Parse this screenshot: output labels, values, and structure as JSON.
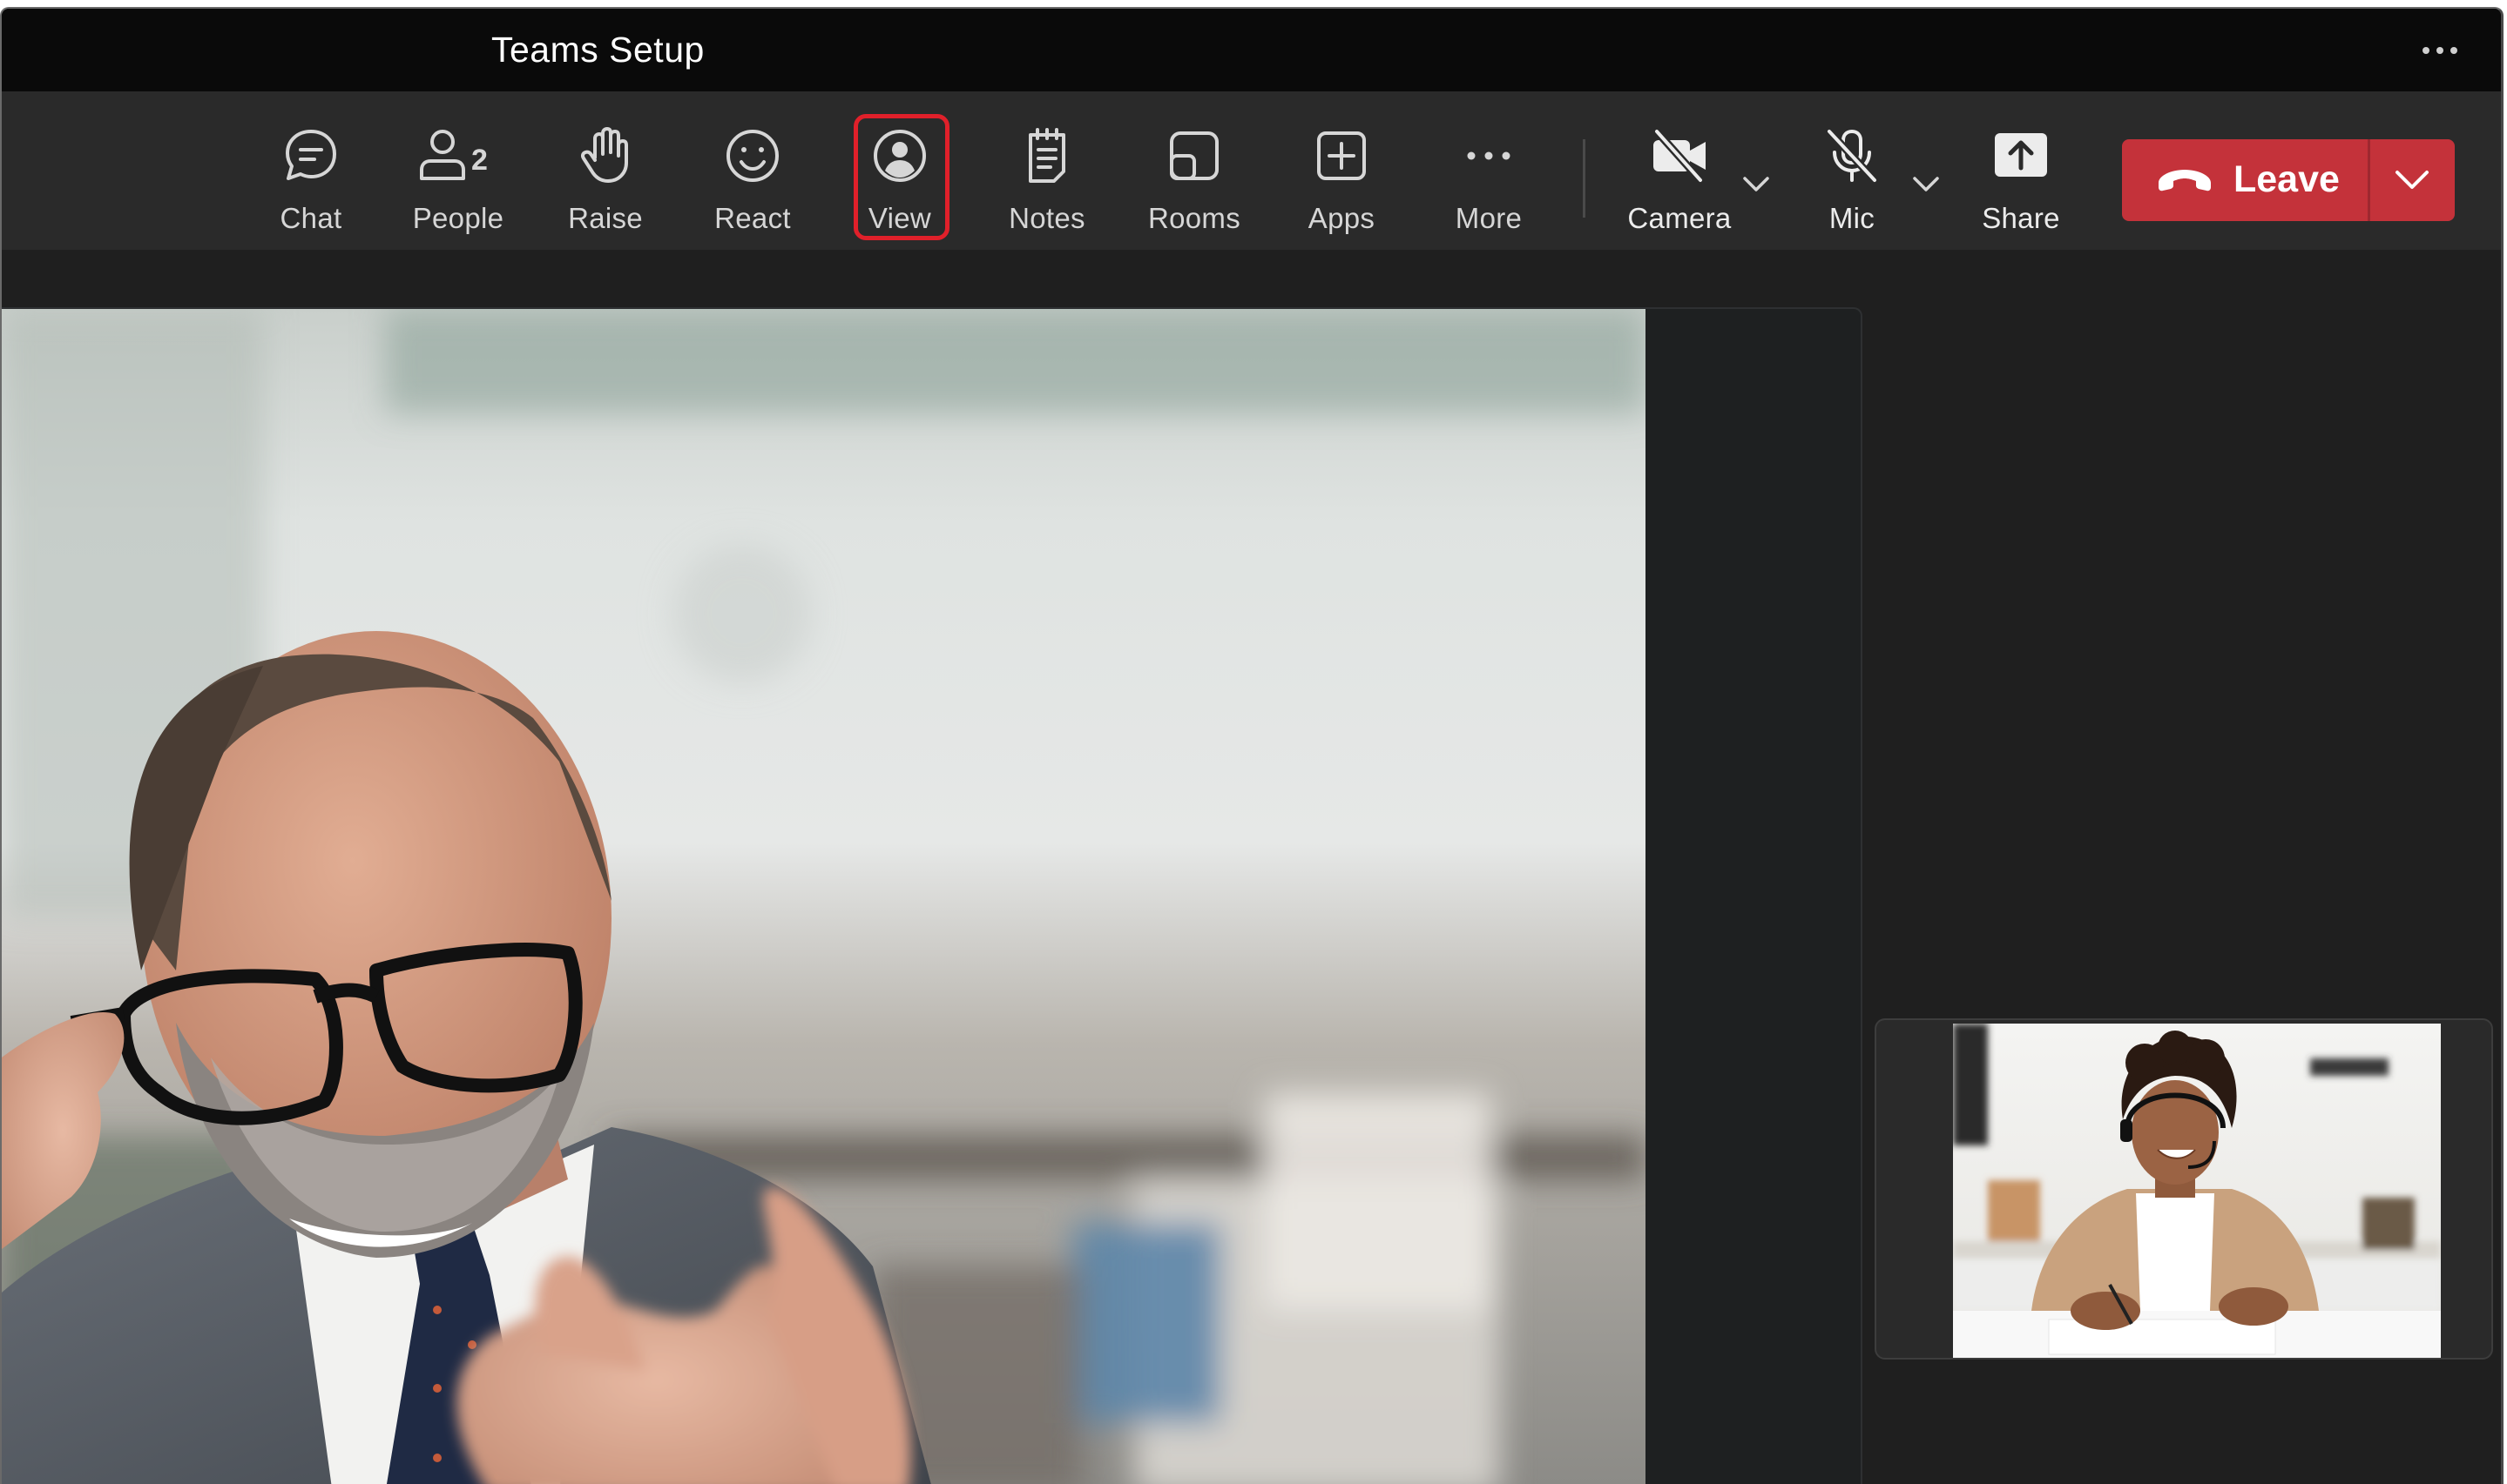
{
  "window": {
    "title": "Teams Setup",
    "more_icon": "more-horizontal-icon"
  },
  "toolbar": {
    "items": [
      {
        "id": "chat",
        "label": "Chat",
        "icon": "chat-bubble-icon"
      },
      {
        "id": "people",
        "label": "People",
        "icon": "people-icon",
        "count": "2"
      },
      {
        "id": "raise",
        "label": "Raise",
        "icon": "raise-hand-icon"
      },
      {
        "id": "react",
        "label": "React",
        "icon": "smiley-icon"
      },
      {
        "id": "view",
        "label": "View",
        "icon": "view-person-icon",
        "highlighted": true
      },
      {
        "id": "notes",
        "label": "Notes",
        "icon": "notes-icon"
      },
      {
        "id": "rooms",
        "label": "Rooms",
        "icon": "rooms-icon"
      },
      {
        "id": "apps",
        "label": "Apps",
        "icon": "apps-plus-icon"
      },
      {
        "id": "more",
        "label": "More",
        "icon": "more-horizontal-icon"
      }
    ],
    "camera": {
      "label": "Camera",
      "icon": "camera-off-icon",
      "state": "off"
    },
    "mic": {
      "label": "Mic",
      "icon": "mic-off-icon",
      "state": "muted"
    },
    "share": {
      "label": "Share",
      "icon": "share-upload-icon"
    },
    "leave": {
      "label": "Leave",
      "icon": "phone-hangup-icon"
    }
  },
  "colors": {
    "leave_red": "#c4323a",
    "highlight_red": "#e0202a",
    "toolbar_bg": "#2a2a2a",
    "titlebar_bg": "#0a0a0a",
    "stage_bg": "#1e2021"
  }
}
